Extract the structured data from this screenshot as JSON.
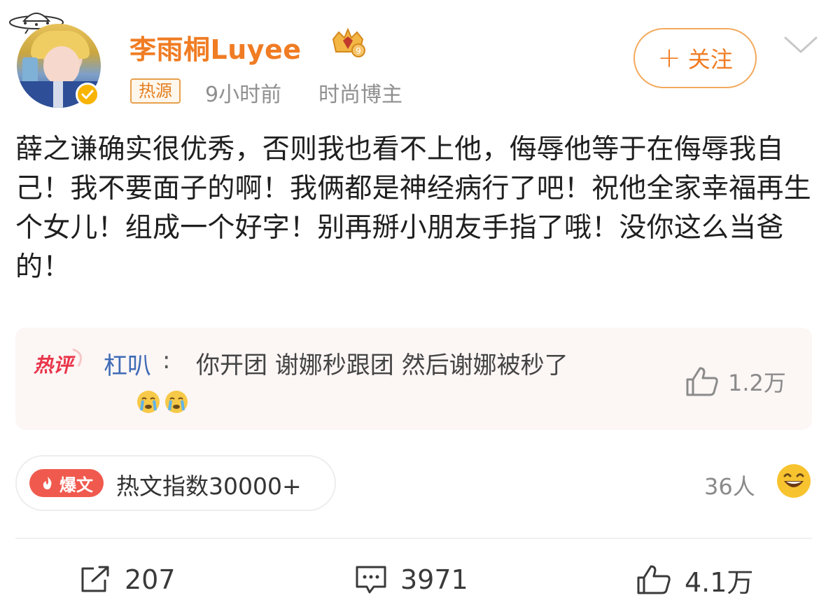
{
  "header": {
    "username": "李雨桐Luyee",
    "hot_source_label": "热源",
    "time": "9小时前",
    "tag": "时尚博主",
    "follow_label": "关注",
    "icons": [
      "ufo-icon",
      "avatar",
      "verified-badge-icon",
      "crown-level-icon",
      "plus-icon",
      "chevron-down-icon"
    ]
  },
  "post": {
    "text": "薛之谦确实很优秀，否则我也看不上他，侮辱他等于在侮辱我自己！我不要面子的啊！我俩都是神经病行了吧！祝他全家幸福再生个女儿！组成一个好字！别再掰小朋友手指了哦！没你这么当爸的！"
  },
  "hot_comment": {
    "badge": "热评",
    "author": "杠叭",
    "colon": ":",
    "text": "你开团 谢娜秒跟团 然后谢娜被秒了",
    "emojis": [
      "crying-face-icon",
      "crying-face-icon"
    ],
    "like_count": "1.2万"
  },
  "hot_index": {
    "badge_label": "爆文",
    "text": "热文指数30000+"
  },
  "reactions": {
    "people": "36人",
    "emoji": "laughing-face-icon"
  },
  "actions": {
    "repost": "207",
    "comment": "3971",
    "like": "4.1万"
  },
  "colors": {
    "username": "#f07c23",
    "link_blue": "#3f6bb6",
    "hot_badge": "#e8354a",
    "baowen_red": "#f05a4e",
    "verified": "#f8b400"
  }
}
